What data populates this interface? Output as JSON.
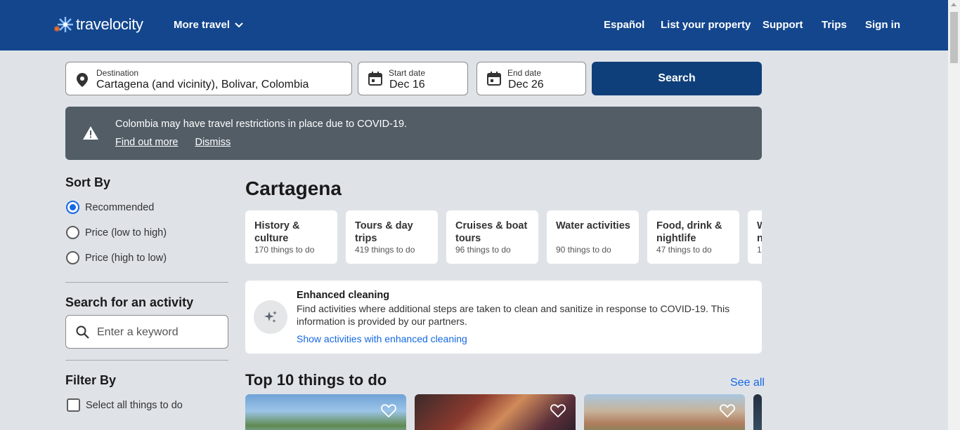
{
  "header": {
    "logo_text": "travelocity",
    "more_travel": "More travel",
    "nav": [
      "Español",
      "List your property",
      "Support",
      "Trips",
      "Sign in"
    ]
  },
  "search": {
    "destination_label": "Destination",
    "destination_value": "Cartagena (and vicinity), Bolivar, Colombia",
    "start_label": "Start date",
    "start_value": "Dec 16",
    "end_label": "End date",
    "end_value": "Dec 26",
    "button": "Search"
  },
  "alert": {
    "text": "Colombia may have travel restrictions in place due to COVID-19.",
    "link_more": "Find out more",
    "link_dismiss": "Dismiss"
  },
  "sidebar": {
    "sort_title": "Sort By",
    "sort_options": [
      {
        "label": "Recommended",
        "checked": true
      },
      {
        "label": "Price (low to high)",
        "checked": false
      },
      {
        "label": "Price (high to low)",
        "checked": false
      }
    ],
    "search_title": "Search for an activity",
    "search_placeholder": "Enter a keyword",
    "filter_title": "Filter By",
    "select_all": "Select all things to do"
  },
  "main": {
    "title": "Cartagena",
    "categories": [
      {
        "name": "History & culture",
        "count": "170 things to do"
      },
      {
        "name": "Tours & day trips",
        "count": "419 things to do"
      },
      {
        "name": "Cruises & boat tours",
        "count": "96 things to do"
      },
      {
        "name": "Water activities",
        "count": "90 things to do"
      },
      {
        "name": "Food, drink & nightlife",
        "count": "47 things to do"
      },
      {
        "name": "W n",
        "count": "1"
      }
    ],
    "cleaning": {
      "title": "Enhanced cleaning",
      "desc": "Find activities where additional steps are taken to clean and sanitize in response to COVID-19. This information is provided by our partners.",
      "link": "Show activities with enhanced cleaning"
    },
    "top10_title": "Top 10 things to do",
    "see_all": "See all"
  },
  "colors": {
    "header": "#13468d",
    "button": "#0f3f7a",
    "link": "#1668e3",
    "alert": "#525d66"
  }
}
